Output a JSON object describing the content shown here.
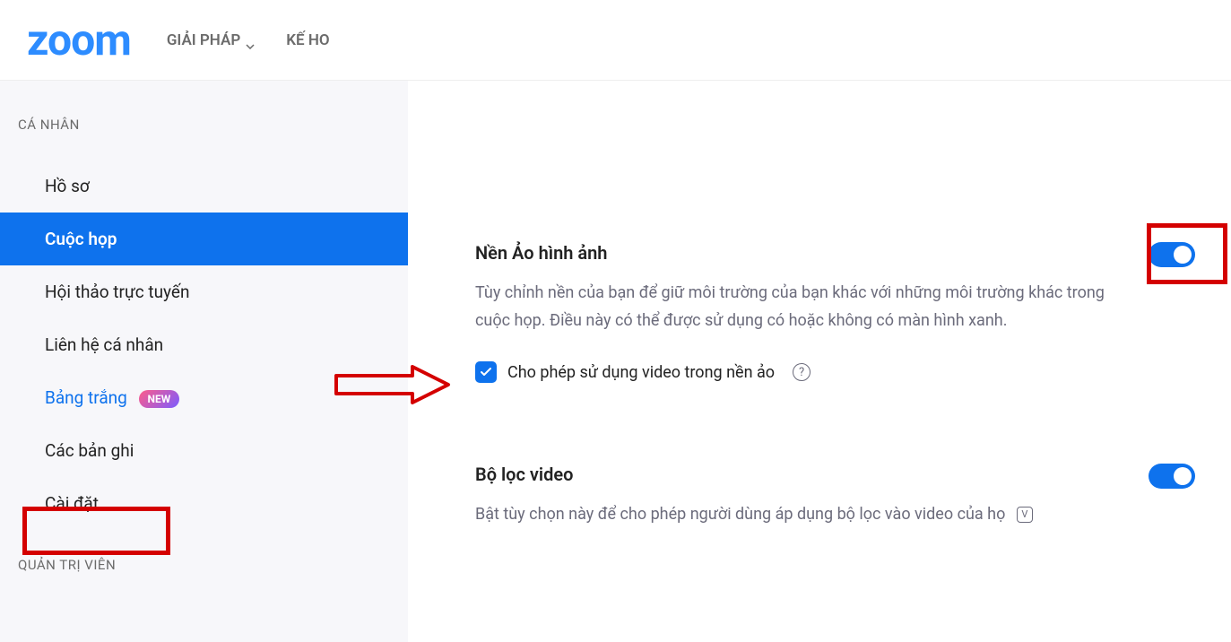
{
  "header": {
    "logo": "zoom",
    "nav1": "GIẢI PHÁP",
    "nav2": "KẾ HO"
  },
  "sidebar": {
    "section1": "CÁ NHÂN",
    "items": [
      {
        "label": "Hồ sơ"
      },
      {
        "label": "Cuộc họp"
      },
      {
        "label": "Hội thảo trực tuyến"
      },
      {
        "label": "Liên hệ cá nhân"
      },
      {
        "label": "Bảng trắng",
        "badge": "NEW"
      },
      {
        "label": "Các bản ghi"
      },
      {
        "label": "Cài đặt"
      }
    ],
    "section2": "QUẢN TRỊ VIÊN"
  },
  "settings": {
    "virtual_bg": {
      "title": "Nền Ảo hình ảnh",
      "desc": "Tùy chỉnh nền của bạn để giữ môi trường của bạn khác với những môi trường khác trong cuộc họp. Điều này có thể được sử dụng có hoặc không có màn hình xanh.",
      "checkbox_label": "Cho phép sử dụng video trong nền ảo"
    },
    "video_filter": {
      "title": "Bộ lọc video",
      "desc": "Bật tùy chọn này để cho phép người dùng áp dụng bộ lọc vào video của họ"
    }
  }
}
